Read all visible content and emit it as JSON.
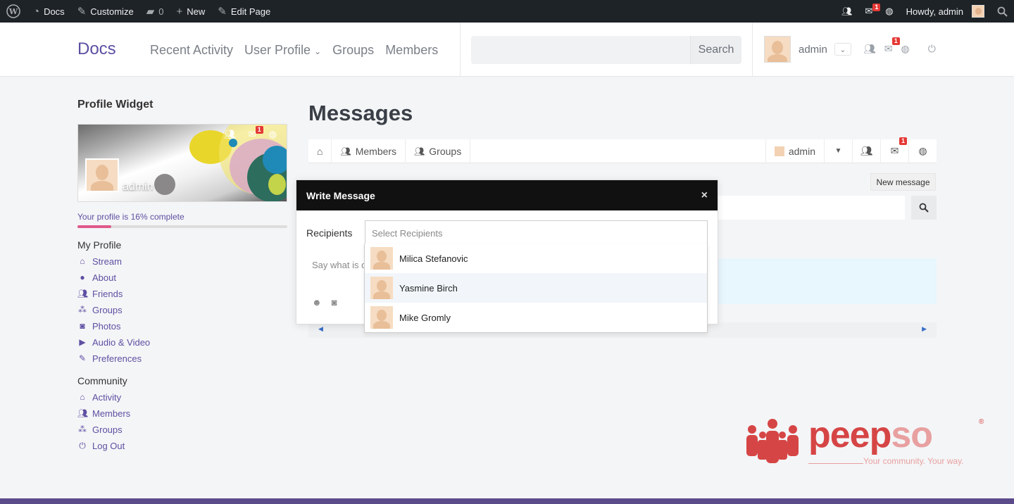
{
  "adminbar": {
    "site": "Docs",
    "customize": "Customize",
    "comments_count": "0",
    "new_label": "New",
    "edit_page": "Edit Page",
    "notification_badge": "1",
    "greeting": "Howdy, admin"
  },
  "header": {
    "brand": "Docs",
    "nav": [
      "Recent Activity",
      "User Profile",
      "Groups",
      "Members"
    ],
    "search_button": "Search",
    "user_name": "admin",
    "message_badge": "1"
  },
  "sidebar": {
    "widget_title": "Profile Widget",
    "cover_name": "admin",
    "cover_badge": "1",
    "progress_text": "Your profile is 16% complete",
    "progress_fraction": 0.16,
    "my_profile_title": "My Profile",
    "my_profile_links": [
      {
        "icon": "home-icon",
        "label": "Stream"
      },
      {
        "icon": "user-icon",
        "label": "About"
      },
      {
        "icon": "friends-icon",
        "label": "Friends"
      },
      {
        "icon": "groups-icon",
        "label": "Groups"
      },
      {
        "icon": "camera-icon",
        "label": "Photos"
      },
      {
        "icon": "video-icon",
        "label": "Audio & Video"
      },
      {
        "icon": "edit-icon",
        "label": "Preferences"
      }
    ],
    "community_title": "Community",
    "community_links": [
      {
        "icon": "home-icon",
        "label": "Activity"
      },
      {
        "icon": "friends-icon",
        "label": "Members"
      },
      {
        "icon": "groups-icon",
        "label": "Groups"
      },
      {
        "icon": "power-icon",
        "label": "Log Out"
      }
    ]
  },
  "main": {
    "title": "Messages",
    "nav_members": "Members",
    "nav_groups": "Groups",
    "nav_user": "admin",
    "nav_badge": "1",
    "new_message": "New message"
  },
  "modal": {
    "title": "Write Message",
    "close": "×",
    "recipients_label": "Recipients",
    "recipients_placeholder": "Select Recipients",
    "message_placeholder": "Say what is o",
    "options": [
      "Milica Stefanovic",
      "Yasmine Birch",
      "Mike Gromly"
    ]
  },
  "logo": {
    "word_main": "peep",
    "word_accent": "so",
    "registered": "®",
    "tagline": "Your community. Your way."
  },
  "colors": {
    "accent": "#5e4fa2",
    "adminbar": "#1d2327",
    "badge": "#e53935",
    "logo": "#d64545"
  }
}
